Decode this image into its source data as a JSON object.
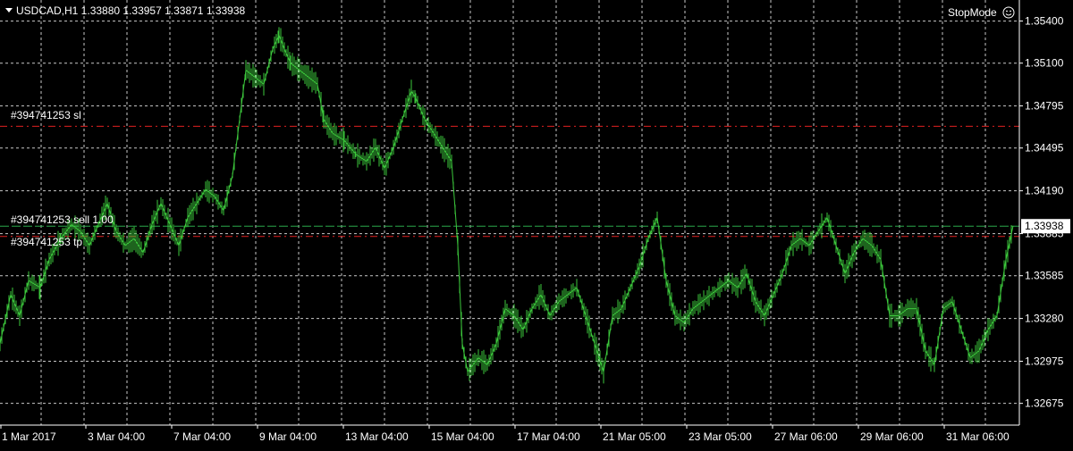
{
  "header": {
    "symbol_line": "USDCAD,H1  1.33880 1.33957 1.33871 1.33938",
    "mode_label": "StopMode"
  },
  "orders": {
    "sl_label": "#394741253 sl",
    "entry_label": "#394741253 sell 1.00",
    "tp_label": "#394741253 tp"
  },
  "colors": {
    "background": "#000000",
    "grid": "#c8c8c8",
    "price_line": "#3cc83c",
    "order_line": "#2aa84a",
    "stop_line": "#e02020",
    "text": "#ffffff"
  },
  "chart_data": {
    "type": "line",
    "symbol": "USDCAD",
    "timeframe": "H1",
    "ohlc_last": {
      "open": 1.3388,
      "high": 1.33957,
      "low": 1.33871,
      "close": 1.33938
    },
    "ylim": [
      1.3252,
      1.3555
    ],
    "y_ticks": [
      "1.35400",
      "1.35100",
      "1.34795",
      "1.34495",
      "1.34190",
      "1.33885",
      "1.33585",
      "1.33280",
      "1.32975",
      "1.32675"
    ],
    "x_ticks": [
      "1 Mar 2017",
      "3 Mar 04:00",
      "7 Mar 04:00",
      "9 Mar 04:00",
      "13 Mar 04:00",
      "15 Mar 04:00",
      "17 Mar 04:00",
      "21 Mar 05:00",
      "23 Mar 05:00",
      "27 Mar 06:00",
      "29 Mar 06:00",
      "31 Mar 06:00"
    ],
    "current_price": "1.33938",
    "levels": {
      "sl": 1.3465,
      "entry": 1.33938,
      "tp": 1.33865
    },
    "grid": true,
    "series": [
      {
        "x": [
          0,
          12,
          22,
          32,
          45,
          55,
          68,
          80,
          90,
          100,
          110,
          120,
          130,
          140,
          150,
          160,
          170,
          180,
          190,
          200,
          210,
          220,
          230,
          240,
          250,
          260,
          268,
          275,
          285,
          295,
          305,
          312,
          318,
          325,
          335,
          345,
          355,
          362,
          372,
          385,
          398,
          410,
          420,
          430,
          440,
          450,
          460,
          465,
          475,
          485,
          495,
          505,
          512,
          517,
          523,
          535,
          545,
          555,
          565,
          575,
          585,
          595,
          605,
          615,
          625,
          635,
          645,
          655,
          665,
          675,
          685,
          695,
          705,
          715,
          725,
          735,
          745,
          755,
          765,
          775,
          785,
          795,
          805,
          815,
          825,
          835,
          845,
          855,
          865,
          875,
          885,
          895,
          905,
          915,
          925,
          935,
          945,
          955,
          965,
          975,
          985,
          995,
          1005,
          1015,
          1025,
          1035,
          1045,
          1055,
          1065,
          1075,
          1085,
          1095,
          1105,
          1115,
          1125,
          1133
        ],
        "y": [
          1.331,
          1.3345,
          1.333,
          1.3355,
          1.335,
          1.337,
          1.3385,
          1.3395,
          1.339,
          1.338,
          1.3395,
          1.341,
          1.339,
          1.338,
          1.3385,
          1.3375,
          1.3395,
          1.341,
          1.3395,
          1.338,
          1.34,
          1.341,
          1.342,
          1.3415,
          1.3405,
          1.343,
          1.347,
          1.3505,
          1.35,
          1.3495,
          1.352,
          1.353,
          1.352,
          1.351,
          1.3505,
          1.35,
          1.3495,
          1.347,
          1.346,
          1.3455,
          1.3445,
          1.344,
          1.345,
          1.3435,
          1.345,
          1.347,
          1.349,
          1.3485,
          1.347,
          1.346,
          1.345,
          1.344,
          1.338,
          1.331,
          1.329,
          1.33,
          1.3295,
          1.331,
          1.3335,
          1.333,
          1.332,
          1.3335,
          1.3345,
          1.333,
          1.334,
          1.3345,
          1.335,
          1.333,
          1.331,
          1.329,
          1.333,
          1.3335,
          1.335,
          1.3365,
          1.3385,
          1.34,
          1.3355,
          1.333,
          1.3325,
          1.3335,
          1.334,
          1.3345,
          1.335,
          1.3355,
          1.335,
          1.336,
          1.334,
          1.333,
          1.3345,
          1.336,
          1.338,
          1.3385,
          1.338,
          1.339,
          1.34,
          1.338,
          1.336,
          1.3375,
          1.3385,
          1.338,
          1.337,
          1.333,
          1.333,
          1.3335,
          1.3335,
          1.3305,
          1.3295,
          1.3335,
          1.334,
          1.332,
          1.33,
          1.3305,
          1.332,
          1.333,
          1.337,
          1.3394
        ]
      }
    ]
  }
}
